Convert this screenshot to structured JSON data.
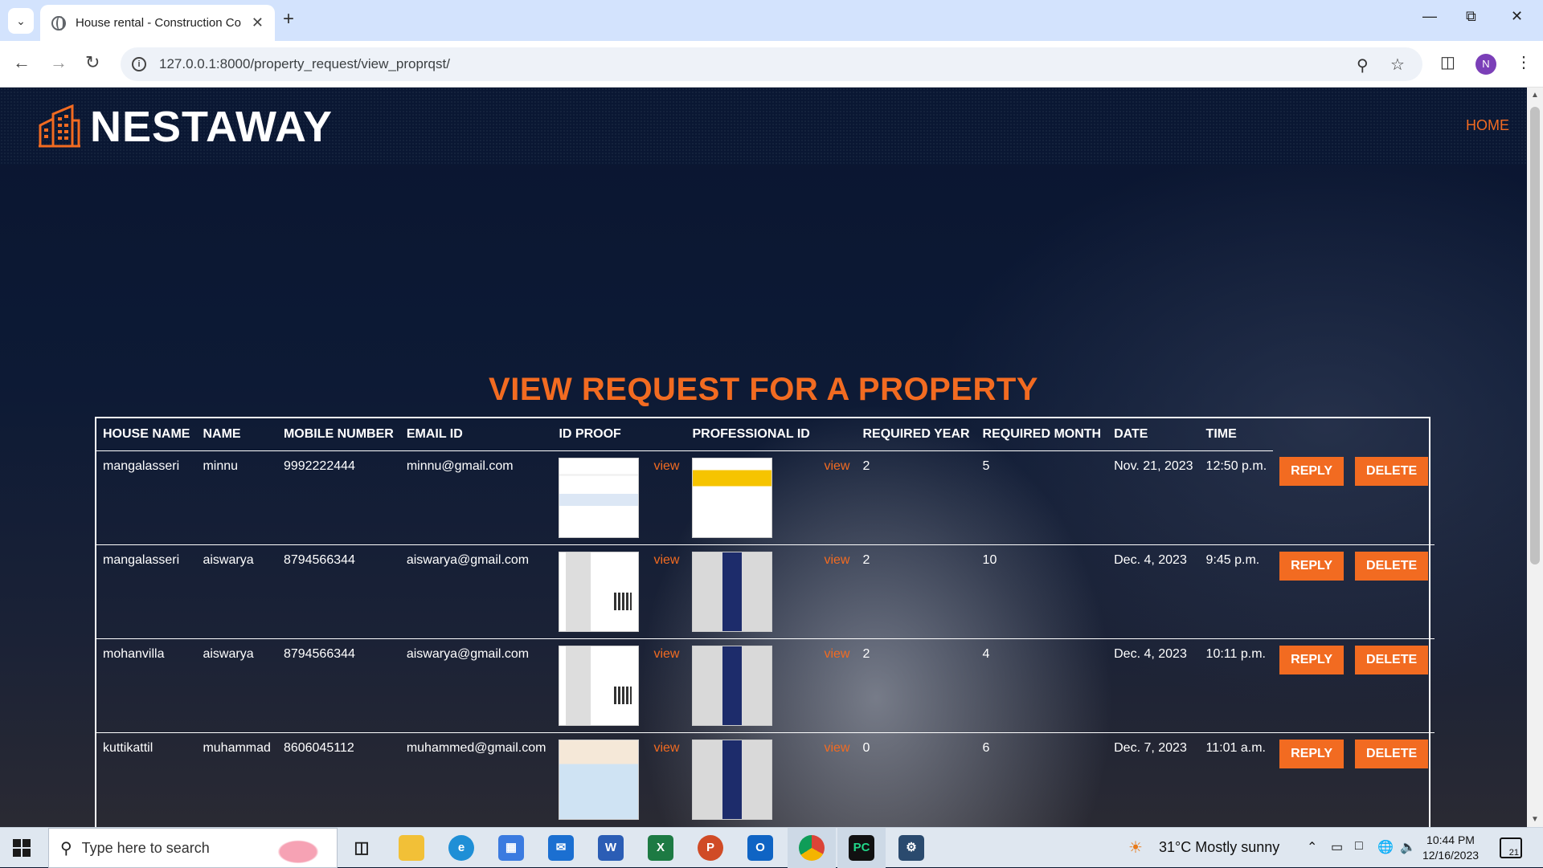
{
  "browser": {
    "tab_title": "House rental - Construction Co",
    "url": "127.0.0.1:8000/property_request/view_proprqst/",
    "profile_initial": "N"
  },
  "site": {
    "brand": "NESTAWAY",
    "nav_home": "HOME",
    "heading": "VIEW REQUEST FOR A PROPERTY",
    "accent_color": "#f26b21"
  },
  "table": {
    "headers": [
      "HOUSE NAME",
      "NAME",
      "MOBILE NUMBER",
      "EMAIL ID",
      "ID PROOF",
      "PROFESSIONAL ID",
      "REQUIRED YEAR",
      "REQUIRED MONTH",
      "DATE",
      "TIME"
    ],
    "view_label": "view",
    "reply_label": "REPLY",
    "delete_label": "DELETE",
    "rows": [
      {
        "house": "mangalasseri",
        "name": "minnu",
        "mobile": "9992222444",
        "email": "minnu@gmail.com",
        "year": "2",
        "month": "5",
        "date": "Nov. 21, 2023",
        "time": "12:50 p.m.",
        "id_thumb": "t-doc",
        "pro_thumb": "t-yellow"
      },
      {
        "house": "mangalasseri",
        "name": "aiswarya",
        "mobile": "8794566344",
        "email": "aiswarya@gmail.com",
        "year": "2",
        "month": "10",
        "date": "Dec. 4, 2023",
        "time": "9:45 p.m.",
        "id_thumb": "t-aadhaar",
        "pro_thumb": "t-badge"
      },
      {
        "house": "mohanvilla",
        "name": "aiswarya",
        "mobile": "8794566344",
        "email": "aiswarya@gmail.com",
        "year": "2",
        "month": "4",
        "date": "Dec. 4, 2023",
        "time": "10:11 p.m.",
        "id_thumb": "t-aadhaar",
        "pro_thumb": "t-badge"
      },
      {
        "house": "kuttikattil",
        "name": "muhammad",
        "mobile": "8606045112",
        "email": "muhammed@gmail.com",
        "year": "0",
        "month": "6",
        "date": "Dec. 7, 2023",
        "time": "11:01 a.m.",
        "id_thumb": "t-pan",
        "pro_thumb": "t-badge"
      }
    ]
  },
  "taskbar": {
    "search_placeholder": "Type here to search",
    "weather": "31°C  Mostly sunny",
    "time": "10:44 PM",
    "date": "12/16/2023",
    "notifications": "21"
  }
}
